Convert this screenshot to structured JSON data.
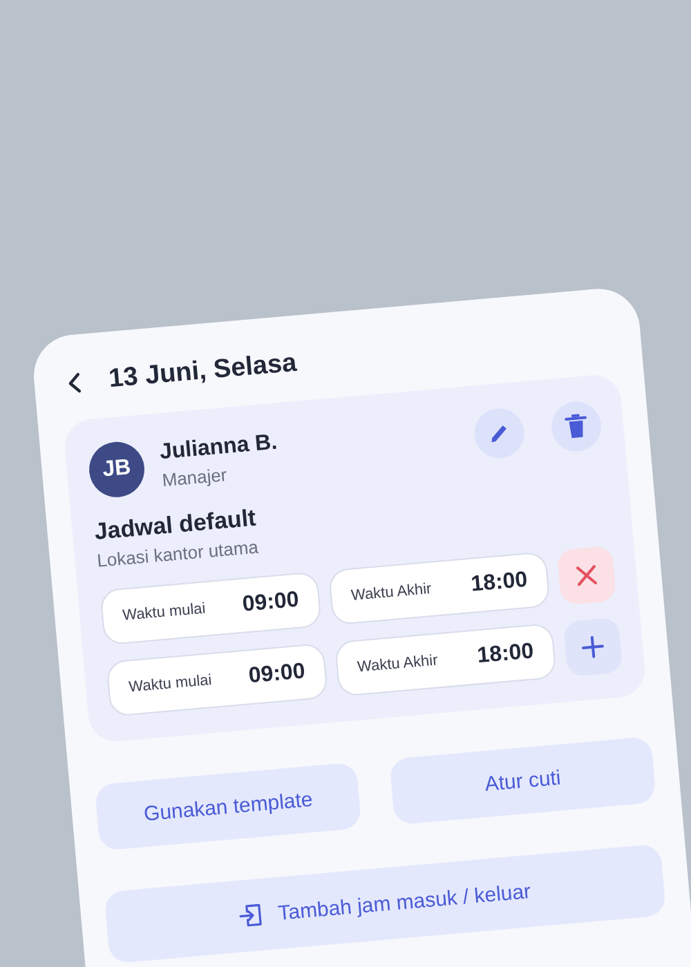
{
  "header": {
    "title": "13 Juni, Selasa"
  },
  "employee": {
    "initials": "JB",
    "name": "Julianna B.",
    "role": "Manajer"
  },
  "schedule": {
    "title": "Jadwal default",
    "location": "Lokasi kantor utama",
    "rows": [
      {
        "start_label": "Waktu mulai",
        "start": "09:00",
        "end_label": "Waktu Akhir",
        "end": "18:00",
        "kind": "remove"
      },
      {
        "start_label": "Waktu mulai",
        "start": "09:00",
        "end_label": "Waktu Akhir",
        "end": "18:00",
        "kind": "add"
      }
    ]
  },
  "buttons": [
    "Gunakan template",
    "Atur cuti"
  ],
  "wide_button": "Tambah jam masuk / keluar"
}
